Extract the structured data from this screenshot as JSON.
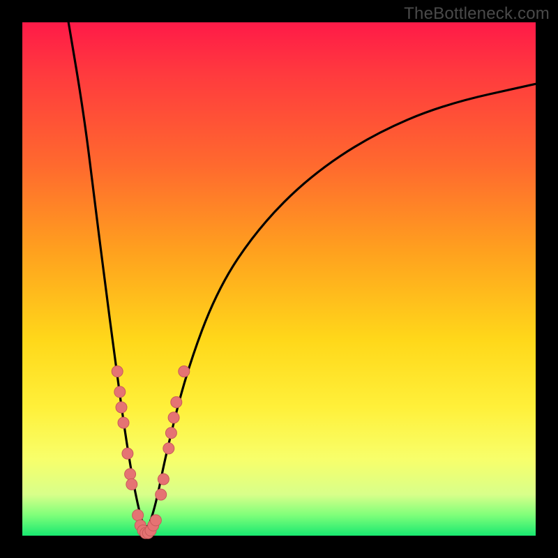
{
  "watermark": "TheBottleneck.com",
  "colors": {
    "background": "#000000",
    "gradient_top": "#ff1a48",
    "gradient_mid": "#ffd81a",
    "gradient_bottom": "#18e870",
    "curve": "#000000",
    "dots": "#e57373",
    "dots_stroke": "#c85a5a"
  },
  "chart_data": {
    "type": "line",
    "title": "",
    "xlabel": "",
    "ylabel": "",
    "xlim": [
      0,
      100
    ],
    "ylim": [
      0,
      100
    ],
    "note": "V-shaped bottleneck curve; min near x≈24; left branch very steep, right branch rises with decreasing slope. Pink dots mark sample points near the valley.",
    "series": [
      {
        "name": "curve",
        "x": [
          9,
          12,
          14,
          16,
          18,
          20,
          22,
          24,
          26,
          28,
          32,
          38,
          46,
          56,
          68,
          82,
          100
        ],
        "y": [
          100,
          82,
          66,
          50,
          35,
          20,
          8,
          0,
          6,
          16,
          32,
          48,
          60,
          70,
          78,
          84,
          88
        ]
      }
    ],
    "dots": [
      {
        "x": 18.5,
        "y": 32
      },
      {
        "x": 19.0,
        "y": 28
      },
      {
        "x": 19.3,
        "y": 25
      },
      {
        "x": 19.7,
        "y": 22
      },
      {
        "x": 20.5,
        "y": 16
      },
      {
        "x": 21.0,
        "y": 12
      },
      {
        "x": 21.3,
        "y": 10
      },
      {
        "x": 22.5,
        "y": 4
      },
      {
        "x": 23.0,
        "y": 2
      },
      {
        "x": 23.5,
        "y": 1
      },
      {
        "x": 24.0,
        "y": 0.5
      },
      {
        "x": 24.5,
        "y": 0.5
      },
      {
        "x": 25.0,
        "y": 1
      },
      {
        "x": 25.5,
        "y": 2
      },
      {
        "x": 26.0,
        "y": 3
      },
      {
        "x": 27.0,
        "y": 8
      },
      {
        "x": 27.5,
        "y": 11
      },
      {
        "x": 28.5,
        "y": 17
      },
      {
        "x": 29.0,
        "y": 20
      },
      {
        "x": 29.5,
        "y": 23
      },
      {
        "x": 30.0,
        "y": 26
      },
      {
        "x": 31.5,
        "y": 32
      }
    ]
  }
}
